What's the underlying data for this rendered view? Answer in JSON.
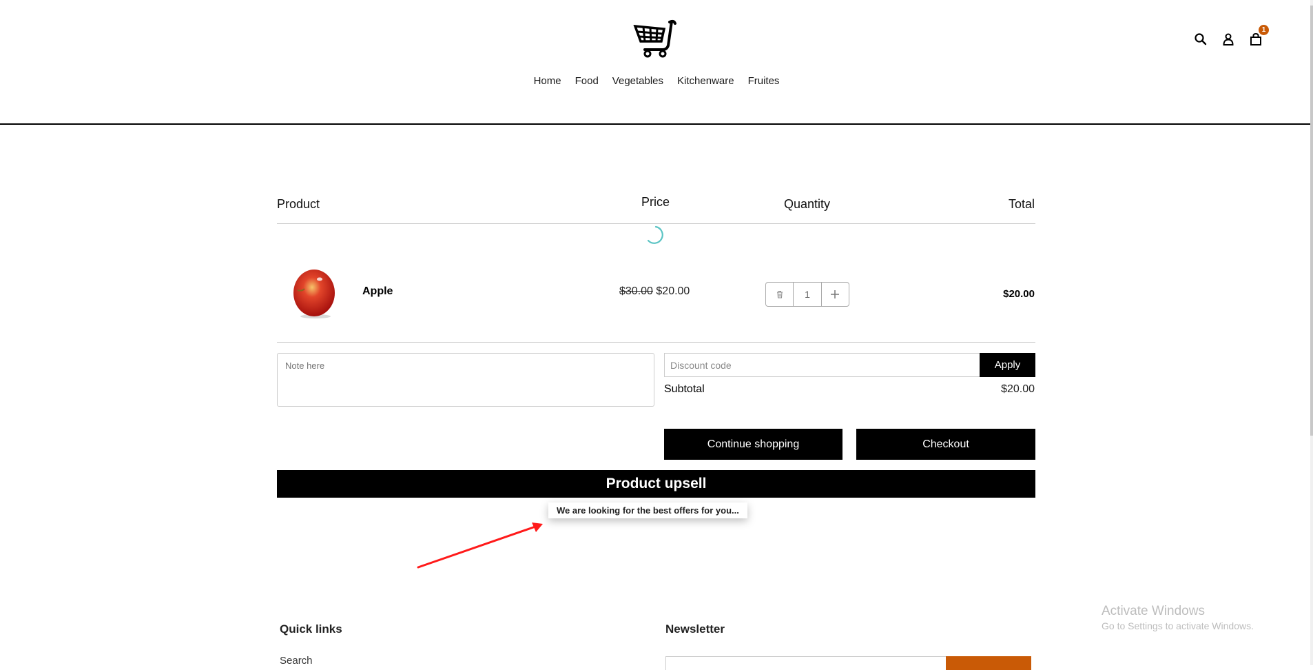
{
  "header": {
    "logo": "shopping-cart-logo",
    "nav": [
      "Home",
      "Food",
      "Vegetables",
      "Kitchenware",
      "Fruites"
    ],
    "icons": [
      "search-icon",
      "account-icon",
      "cart-bag-icon"
    ],
    "cart_count": "1",
    "badge_color": "#c95a06"
  },
  "cart": {
    "columns": {
      "product": "Product",
      "price": "Price",
      "quantity": "Quantity",
      "total": "Total"
    },
    "items": [
      {
        "name": "Apple",
        "image": "apple",
        "compare_price": "$30.00",
        "price": "$20.00",
        "quantity": "1",
        "line_total": "$20.00"
      }
    ],
    "note_placeholder": "Note here",
    "discount_placeholder": "Discount code",
    "apply_label": "Apply",
    "subtotal_label": "Subtotal",
    "subtotal_value": "$20.00",
    "continue_label": "Continue shopping",
    "checkout_label": "Checkout"
  },
  "upsell": {
    "title": "Product upsell",
    "message": "We are looking for the best offers for you..."
  },
  "footer": {
    "quick_links_title": "Quick links",
    "quick_links": [
      "Search"
    ],
    "newsletter_title": "Newsletter",
    "accent": "#c95a06"
  },
  "overlay": {
    "activate_title": "Activate Windows",
    "activate_sub": "Go to Settings to activate Windows."
  }
}
